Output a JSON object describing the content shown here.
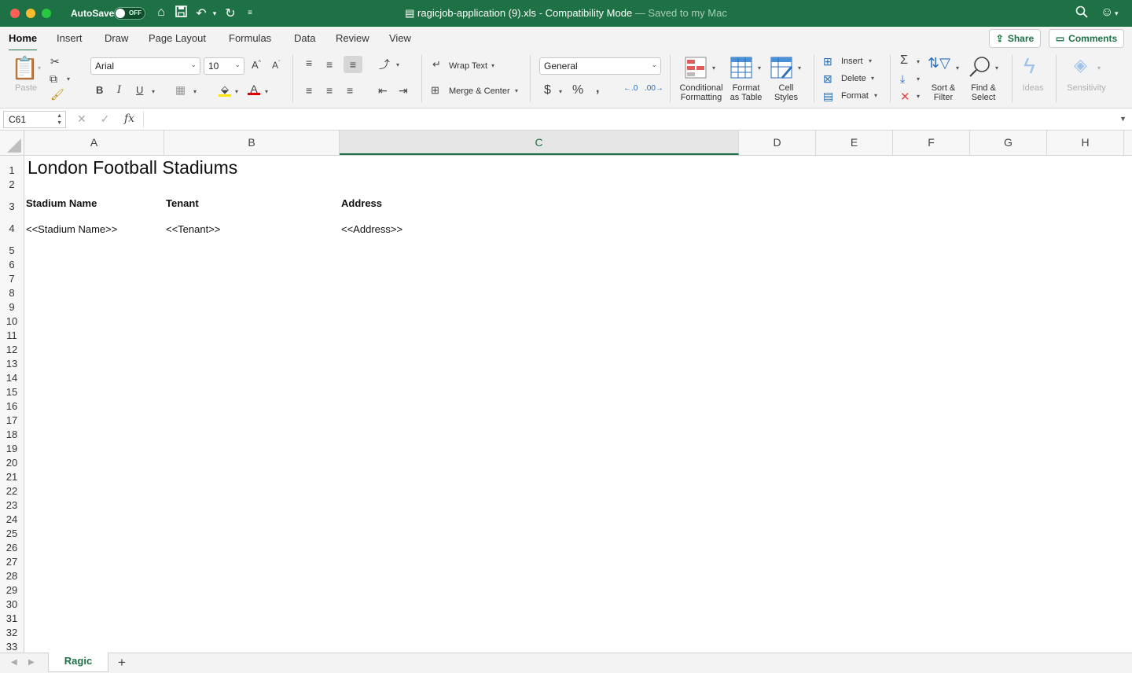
{
  "titlebar": {
    "autosave_label": "AutoSave",
    "autosave_state": "OFF",
    "file_name": "ragicjob-application (9).xls",
    "mode": "Compatibility Mode",
    "save_status": "— Saved to my Mac"
  },
  "tabs": [
    "Home",
    "Insert",
    "Draw",
    "Page Layout",
    "Formulas",
    "Data",
    "Review",
    "View"
  ],
  "share_label": "Share",
  "comments_label": "Comments",
  "ribbon": {
    "paste_label": "Paste",
    "font_name": "Arial",
    "font_size": "10",
    "wrap_text": "Wrap Text",
    "merge_center": "Merge & Center",
    "number_format": "General",
    "conditional_formatting": [
      "Conditional",
      "Formatting"
    ],
    "format_as_table": [
      "Format",
      "as Table"
    ],
    "cell_styles": [
      "Cell",
      "Styles"
    ],
    "insert_label": "Insert",
    "delete_label": "Delete",
    "format_label": "Format",
    "sort_filter": [
      "Sort &",
      "Filter"
    ],
    "find_select": [
      "Find &",
      "Select"
    ],
    "ideas_label": "Ideas",
    "sensitivity_label": "Sensitivity"
  },
  "formula_bar": {
    "name_box": "C61",
    "fx": "fx",
    "content": ""
  },
  "columns": [
    "A",
    "B",
    "C",
    "D",
    "E",
    "F",
    "G",
    "H"
  ],
  "selected_column": "C",
  "rows": [
    "1",
    "2",
    "3",
    "4",
    "5",
    "6",
    "7",
    "8",
    "9",
    "10",
    "11",
    "12",
    "13",
    "14",
    "15",
    "16",
    "17",
    "18",
    "19",
    "20",
    "21",
    "22",
    "23",
    "24",
    "25",
    "26",
    "27",
    "28",
    "29",
    "30",
    "31",
    "32",
    "33"
  ],
  "sheet": {
    "title": "London Football Stadiums",
    "headers": [
      "Stadium Name",
      "Tenant",
      "Address"
    ],
    "row4": [
      "<<Stadium Name>>",
      "<<Tenant>>",
      "<<Address>>"
    ]
  },
  "sheet_tabs": [
    "Ragic"
  ],
  "colors": {
    "accent": "#1e7145"
  }
}
